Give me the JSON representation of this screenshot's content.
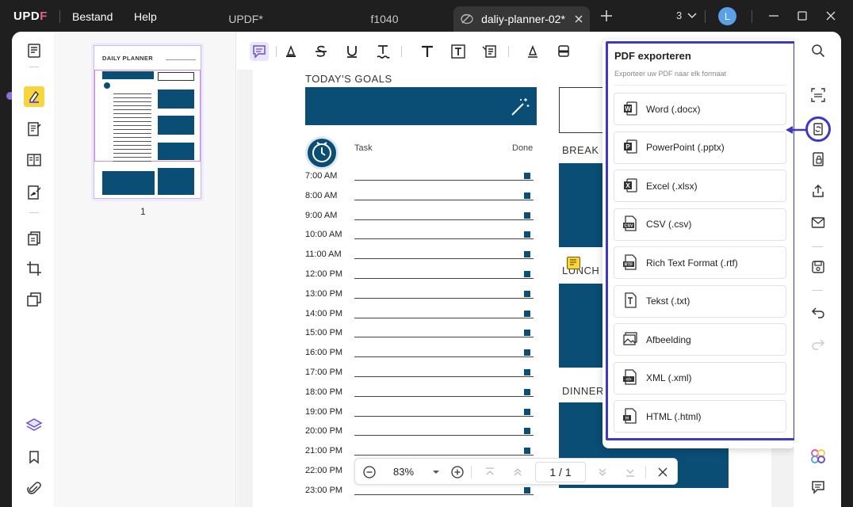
{
  "titlebar": {
    "logo_up": "UP",
    "logo_d": "D",
    "logo_f": "F",
    "menu": [
      "Bestand",
      "Help"
    ],
    "tabs": [
      "UPDF*",
      "f1040",
      "daliy-planner-02*"
    ],
    "tab_count": "3",
    "avatar_letter": "L",
    "accent": "#5aa0e8"
  },
  "thumbnails": {
    "page_number": "1",
    "thumb_title": "DAILY PLANNER"
  },
  "page": {
    "goals_title": "TODAY'S GOALS",
    "col_task": "Task",
    "col_done": "Done",
    "times": [
      "7:00 AM",
      "8:00 AM",
      "9:00 AM",
      "10:00 AM",
      "11:00 AM",
      "12:00 PM",
      "13:00 PM",
      "14:00 PM",
      "15:00 PM",
      "16:00 PM",
      "17:00 PM",
      "18:00 PM",
      "19:00 PM",
      "20:00 PM",
      "21:00 PM",
      "22:00 PM",
      "23:00 PM"
    ],
    "side_labels": [
      "BREAK",
      "LUNCH",
      "DINNER"
    ],
    "brand_color": "#0a4d75"
  },
  "zoombar": {
    "zoom": "83%",
    "current_page": "1",
    "separator": "/",
    "total_pages": "1"
  },
  "export_panel": {
    "title": "PDF exporteren",
    "subtitle": "Exporteer uw PDF naar elk formaat",
    "highlight_color": "#3d39c4",
    "options": [
      {
        "label": "Word (.docx)",
        "icon": "word-icon"
      },
      {
        "label": "PowerPoint (.pptx)",
        "icon": "powerpoint-icon"
      },
      {
        "label": "Excel (.xlsx)",
        "icon": "excel-icon"
      },
      {
        "label": "CSV (.csv)",
        "icon": "csv-icon"
      },
      {
        "label": "Rich Text Format (.rtf)",
        "icon": "rtf-icon"
      },
      {
        "label": "Tekst (.txt)",
        "icon": "txt-icon"
      },
      {
        "label": "Afbeelding",
        "icon": "image-icon"
      },
      {
        "label": "XML (.xml)",
        "icon": "xml-icon"
      },
      {
        "label": "HTML (.html)",
        "icon": "html-icon"
      }
    ]
  }
}
